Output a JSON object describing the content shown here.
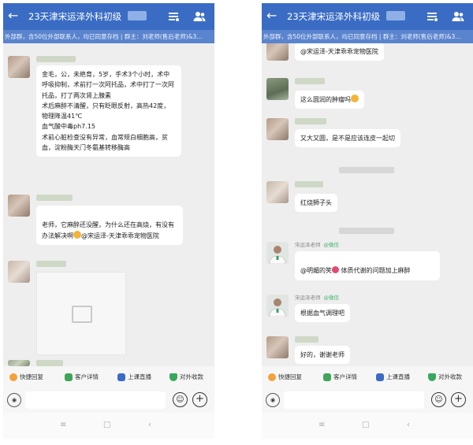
{
  "left": {
    "header": {
      "title": "23天津宋运泽外科初级",
      "back_icon": "←"
    },
    "notice": "外部群，含50位外部联系人，均已同意存档 | 群主：刘老师(售后老师)&3...",
    "messages": {
      "m1": {
        "text": "金毛，公，未绝育，5岁，手术3个小时，术中呼吸抑制，术前打一次阿托品，术中打了一次阿托品，打了两次肾上腺素\n术后麻醉不清醒，只有眨眼反射，高热42度，物理降温41℃\n血气酸中毒ph7.15\n术前心脏检查没有异常，血常规白细胞高，贫血，淀粉酶天门冬氨基转移酶高"
      },
      "m2": {
        "text_before": "老师，它麻醉还没醒，为什么还在高烧，有没有办法解决啊",
        "text_after": "@宋运泽-天津乖乖宠物医院"
      }
    },
    "quick_bar": [
      "快捷回复",
      "客户详情",
      "上课直播",
      "对外收款"
    ],
    "nav": {
      "menu": "≡",
      "home": "□",
      "back": "‹"
    }
  },
  "right": {
    "header": {
      "title": "23天津宋运泽外科初级",
      "back_icon": "←"
    },
    "notice": "外部群，含50位外部联系人，均已同意存档 | 群主：刘老师(售后老师)&3...",
    "messages": {
      "r1": {
        "text": "@宋运泽-天津乖乖宠物医院"
      },
      "r2": {
        "text": "这么圆润的肿瘤吗"
      },
      "r3": {
        "text": "又大又圆，是不是应该连皮一起切"
      },
      "r4": {
        "text": "红烧狮子头"
      },
      "r5": {
        "sender": "宋运泽老师",
        "tag": "@微信",
        "text_before": "@明媚的笑",
        "text_after": " 体质代谢的问题加上麻醉"
      },
      "r6": {
        "sender": "宋运泽老师",
        "tag": "@微信",
        "text": "根据血气调理吧"
      },
      "r7": {
        "text": "好的，谢谢老师"
      }
    },
    "quick_bar": [
      "快捷回复",
      "客户详情",
      "上课直播",
      "对外收款"
    ],
    "nav": {
      "menu": "≡",
      "home": "□",
      "back": "‹"
    }
  },
  "icons": {
    "emoji_button": "☺",
    "plus_button": "+",
    "voice_button": "◉"
  },
  "colors": {
    "header": "#3a6cc4",
    "notice": "#5a84cd",
    "chat_bg": "#eeeeee",
    "vet_tag": "#3cb06b"
  }
}
